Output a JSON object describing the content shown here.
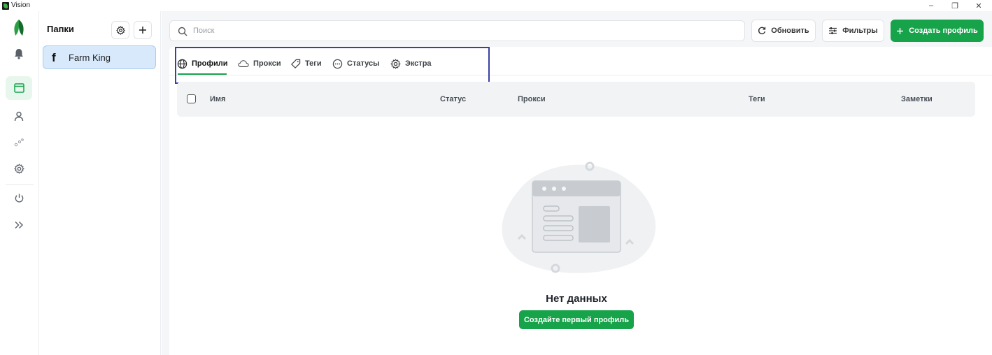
{
  "window": {
    "title": "Vision",
    "controls": {
      "minimize": "–",
      "restore": "❐",
      "close": "✕"
    }
  },
  "rail": {
    "items": [
      {
        "icon": "logo-icon"
      },
      {
        "icon": "bell-icon"
      },
      {
        "icon": "browser-window-icon",
        "active": true
      },
      {
        "icon": "user-icon"
      },
      {
        "icon": "bubbles-icon"
      },
      {
        "icon": "gear-icon"
      },
      {
        "icon": "power-icon"
      },
      {
        "icon": "double-chevron-right-icon"
      }
    ]
  },
  "folders": {
    "title": "Папки",
    "items": [
      {
        "icon": "facebook-icon",
        "icon_glyph": "f",
        "label": "Farm King"
      }
    ]
  },
  "toolbar": {
    "search_placeholder": "Поиск",
    "refresh_label": "Обновить",
    "filters_label": "Фильтры",
    "create_label": "Создать профиль"
  },
  "tabs": [
    {
      "label": "Профили",
      "icon": "globe-icon",
      "active": true
    },
    {
      "label": "Прокси",
      "icon": "cloud-icon"
    },
    {
      "label": "Теги",
      "icon": "tag-icon"
    },
    {
      "label": "Статусы",
      "icon": "dots-circle-icon"
    },
    {
      "label": "Экстра",
      "icon": "gear-icon"
    }
  ],
  "table": {
    "columns": [
      "Имя",
      "Статус",
      "Прокси",
      "Теги",
      "Заметки"
    ]
  },
  "empty_state": {
    "title": "Нет данных",
    "button_label": "Создайте первый профиль"
  },
  "colors": {
    "accent": "#17a34a",
    "selected_folder": "#d7e9fb",
    "highlight_box": "#3b3fa3"
  }
}
